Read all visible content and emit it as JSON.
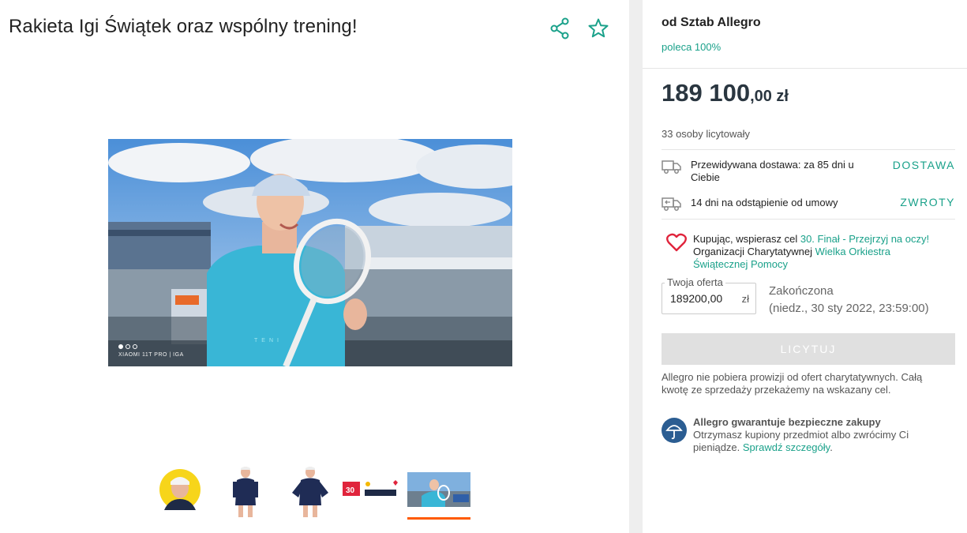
{
  "listing": {
    "title": "Rakieta Igi Świątek oraz wspólny trening!",
    "photo_caption": "XIAOMI 11T PRO | IGA",
    "shirt_text": "TENI",
    "photo_dots": 3,
    "active_dot": 0,
    "thumbnails": [
      {
        "name": "thumb-portrait-yellow"
      },
      {
        "name": "thumb-standing-1"
      },
      {
        "name": "thumb-standing-2"
      },
      {
        "name": "thumb-wosp-banner"
      },
      {
        "name": "thumb-court-photo"
      }
    ],
    "active_thumbnail": 4
  },
  "seller": {
    "name": "od Sztab Allegro",
    "recommend": "poleca 100%"
  },
  "price": {
    "main": "189 100",
    "fraction": ",00 zł"
  },
  "bidders": "33 osoby licytowały",
  "delivery": {
    "text": "Przewidywana dostawa: za 85 dni u Ciebie",
    "link": "DOSTAWA"
  },
  "returns": {
    "text": "14 dni na odstąpienie od umowy",
    "link": "ZWROTY"
  },
  "charity": {
    "part1": "Kupując, wspierasz cel ",
    "goal_link": "30. Finał - Przejrzyj na oczy!",
    "part2": " Organizacji Charytatywnej ",
    "org_link": "Wielka Orkiestra Świątecznej Pomocy"
  },
  "offer": {
    "label": "Twoja oferta",
    "value": "189200,00",
    "currency": "zł"
  },
  "status": {
    "ended": "Zakończona",
    "date": "(niedz., 30 sty 2022, 23:59:00)"
  },
  "bid_button": "LICYTUJ",
  "fee_note": "Allegro nie pobiera prowizji od ofert charytatywnych. Całą kwotę ze sprzedaży przekażemy na wskazany cel.",
  "guarantee": {
    "title": "Allegro gwarantuje bezpieczne zakupy",
    "text": "Otrzymasz kupiony przedmiot albo zwrócimy Ci pieniądze. ",
    "link": "Sprawdź szczegóły",
    "end": "."
  },
  "colors": {
    "accent": "#1aa18a",
    "active_thumb": "#ff5a00",
    "heart": "#e0243c",
    "shield_bg": "#2b5d92"
  },
  "icons": [
    "share-icon",
    "star-icon",
    "truck-icon",
    "return-truck-icon",
    "heart-icon",
    "umbrella-shield-icon"
  ]
}
